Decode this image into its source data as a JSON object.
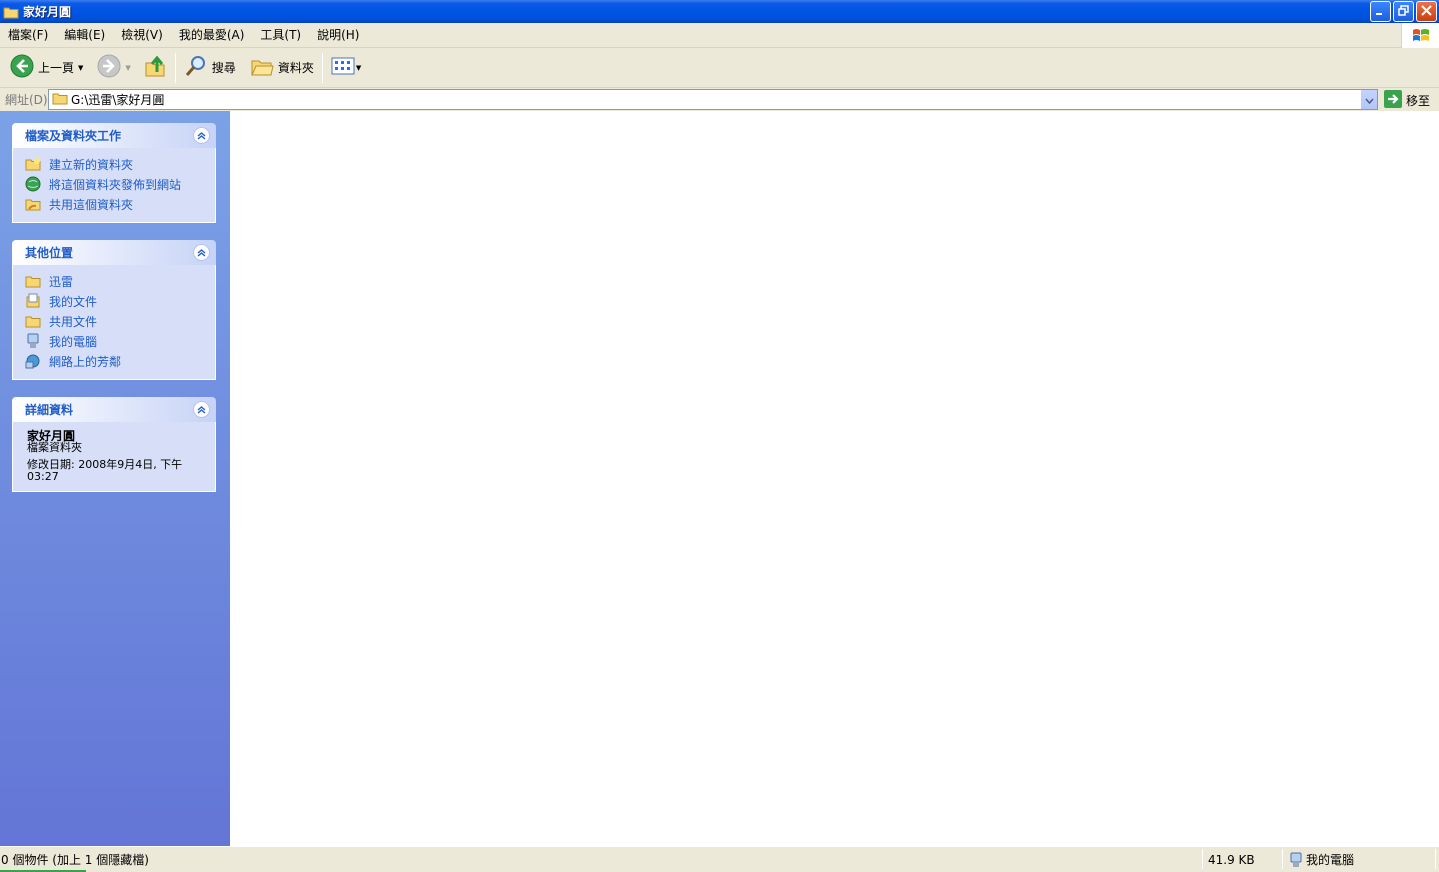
{
  "window": {
    "title": "家好月圓",
    "title_icon": "folder-icon",
    "buttons": [
      "minimize-icon",
      "restore-icon",
      "close-icon"
    ]
  },
  "menu": {
    "items": [
      "檔案(F)",
      "編輯(E)",
      "檢視(V)",
      "我的最愛(A)",
      "工具(T)",
      "說明(H)"
    ]
  },
  "toolbar": {
    "back_label": "上一頁",
    "search_label": "搜尋",
    "folders_label": "資料夾"
  },
  "address": {
    "label": "網址(D)",
    "value": "G:\\迅雷\\家好月圓",
    "go_label": "移至"
  },
  "panels": {
    "tasks": {
      "title": "檔案及資料夾工作",
      "items": [
        {
          "label": "建立新的資料夾",
          "icon": "new-folder-icon"
        },
        {
          "label": "將這個資料夾發佈到網站",
          "icon": "publish-web-icon"
        },
        {
          "label": "共用這個資料夾",
          "icon": "share-folder-icon"
        }
      ]
    },
    "places": {
      "title": "其他位置",
      "items": [
        {
          "label": "迅雷",
          "icon": "folder-icon"
        },
        {
          "label": "我的文件",
          "icon": "my-documents-icon"
        },
        {
          "label": "共用文件",
          "icon": "shared-folder-icon"
        },
        {
          "label": "我的電腦",
          "icon": "my-computer-icon"
        },
        {
          "label": "網路上的芳鄰",
          "icon": "network-places-icon"
        }
      ]
    },
    "details": {
      "title": "詳細資料",
      "name": "家好月圓",
      "type": "檔案資料夾",
      "modified_line1": "修改日期: 2008年9月4日, 下午",
      "modified_line2": "03:27"
    }
  },
  "status": {
    "objects": "0 個物件 (加上 1 個隱藏檔)",
    "size": "41.9 KB",
    "location": "我的電腦"
  },
  "colors": {
    "titlebar": "#0054e3",
    "taskpane_top": "#7ba2e7",
    "taskpane_bottom": "#6375d6",
    "panel_title": "#215dc6",
    "panel_body": "#d6dff7"
  }
}
